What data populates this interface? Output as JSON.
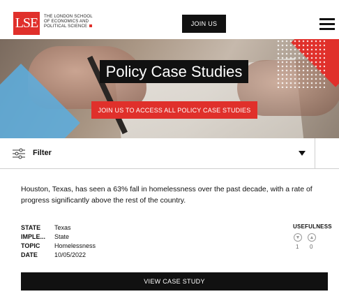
{
  "header": {
    "logo_mark": "LSE",
    "logo_lines": [
      "THE LONDON SCHOOL",
      "OF ECONOMICS AND",
      "POLITICAL SCIENCE"
    ],
    "join_label": "JOIN US",
    "menu_icon": "hamburger-menu-icon"
  },
  "hero": {
    "title": "Policy Case Studies",
    "cta_label": "JOIN US TO ACCESS ALL POLICY CASE STUDIES"
  },
  "filter": {
    "label": "Filter",
    "icon": "sliders-icon",
    "toggle_icon": "caret-down-icon"
  },
  "case_study": {
    "summary": "Houston, Texas, has seen a 63% fall in homelessness over the past decade, with a rate of progress significantly above the rest of the country.",
    "meta": [
      {
        "key": "STATE",
        "value": "Texas"
      },
      {
        "key": "IMPLE...",
        "value": "State"
      },
      {
        "key": "TOPIC",
        "value": "Homelessness"
      },
      {
        "key": "DATE",
        "value": "10/05/2022"
      }
    ],
    "usefulness": {
      "label": "USEFULNESS",
      "down_count": "1",
      "up_count": "0"
    },
    "view_label": "VIEW CASE STUDY"
  },
  "colors": {
    "brand_red": "#e0302b",
    "black": "#111111",
    "accent_blue": "#5aaee0"
  }
}
